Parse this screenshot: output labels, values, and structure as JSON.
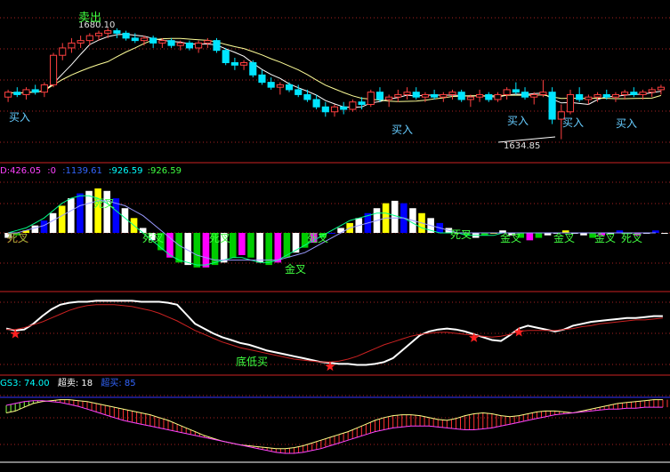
{
  "colors": {
    "background": "#000000",
    "up": "#ff4040",
    "down": "#00e5ff",
    "ma_short": "#ffffff",
    "ma_long": "#ffff99",
    "red_line": "#cc2222",
    "white_line": "#ffffff",
    "hist_blue": "#0000ff",
    "hist_yellow": "#ffff00",
    "hist_white": "#ffffff",
    "hist_green": "#00cc00",
    "hist_magenta": "#ff00ff",
    "dif": "#00ff88",
    "dea": "#9999ff",
    "dif2": "#ff40ff",
    "buy_label": "#66ccff",
    "sell_label": "#40ff40",
    "star": "#ff2020",
    "gs_green": "#88ff44",
    "gs_magenta": "#ff44ff",
    "gs_red": "#ff3333",
    "gs_yellow": "#ffff88",
    "indicator_red_text": "#ff4040",
    "indicator_blue_text": "#3366ff",
    "indicator_white_text": "#ffffff",
    "indicator_cyan_text": "#00ffff",
    "indicator_green_text": "#40ff40",
    "indicator_magenta_text": "#ff40ff"
  },
  "price_panel": {
    "high_label": "1680.10",
    "low_label": "1634.85",
    "sell_label": "卖出",
    "buy_labels": [
      "买入",
      "买入",
      "买入",
      "买入",
      "买入"
    ]
  },
  "macd_panel": {
    "header": {
      "macd": "D:426.05",
      "zero": ":0",
      "dif": ":1139.61",
      "v1": ":926.59",
      "v2": ":926.59"
    },
    "marks": {
      "die_cha": "死叉",
      "jin_cha": "金叉"
    }
  },
  "curve_panel": {
    "label": "底低买"
  },
  "gs_panel": {
    "gs3_label": "GS3:",
    "gs3_value": "74.00",
    "oversold_label": "超卖:",
    "oversold_value": "18",
    "overbought_label": "超买:",
    "overbought_value": "85"
  },
  "chart_data": [
    {
      "type": "candlestick",
      "title": "",
      "annotations": [
        "1680.10",
        "1634.85",
        "卖出",
        "买入"
      ],
      "high": 1680.1,
      "low": 1634.85,
      "ylim": [
        1630,
        1685
      ],
      "grid": true,
      "candles": [
        [
          1652,
          1655,
          1650,
          1654
        ],
        [
          1654,
          1656,
          1652,
          1653
        ],
        [
          1653,
          1656,
          1651,
          1655
        ],
        [
          1655,
          1657,
          1653,
          1654
        ],
        [
          1654,
          1658,
          1652,
          1657
        ],
        [
          1657,
          1670,
          1656,
          1669
        ],
        [
          1669,
          1674,
          1667,
          1672
        ],
        [
          1672,
          1676,
          1670,
          1674
        ],
        [
          1674,
          1677,
          1672,
          1675
        ],
        [
          1675,
          1678,
          1673,
          1677
        ],
        [
          1677,
          1679,
          1675,
          1678
        ],
        [
          1678,
          1680.1,
          1676,
          1679
        ],
        [
          1679,
          1680,
          1676,
          1678
        ],
        [
          1678,
          1679,
          1675,
          1676
        ],
        [
          1676,
          1678,
          1674,
          1675
        ],
        [
          1675,
          1677,
          1673,
          1676
        ],
        [
          1676,
          1677,
          1672,
          1674
        ],
        [
          1674,
          1676,
          1672,
          1675
        ],
        [
          1675,
          1676,
          1672,
          1673
        ],
        [
          1673,
          1675,
          1671,
          1674
        ],
        [
          1674,
          1675,
          1671,
          1672
        ],
        [
          1672,
          1675,
          1670,
          1674
        ],
        [
          1674,
          1676,
          1672,
          1675
        ],
        [
          1675,
          1676,
          1670,
          1671
        ],
        [
          1671,
          1672,
          1665,
          1666
        ],
        [
          1666,
          1668,
          1663,
          1665
        ],
        [
          1665,
          1667,
          1663,
          1666
        ],
        [
          1666,
          1667,
          1660,
          1661
        ],
        [
          1661,
          1663,
          1657,
          1658
        ],
        [
          1658,
          1660,
          1655,
          1656
        ],
        [
          1656,
          1658,
          1653,
          1657
        ],
        [
          1657,
          1658,
          1654,
          1655
        ],
        [
          1655,
          1657,
          1652,
          1653
        ],
        [
          1653,
          1655,
          1650,
          1651
        ],
        [
          1651,
          1653,
          1647,
          1648
        ],
        [
          1648,
          1650,
          1644,
          1646
        ],
        [
          1646,
          1649,
          1644,
          1648
        ],
        [
          1648,
          1650,
          1645,
          1647
        ],
        [
          1647,
          1651,
          1646,
          1650
        ],
        [
          1650,
          1652,
          1647,
          1649
        ],
        [
          1649,
          1655,
          1648,
          1654
        ],
        [
          1654,
          1656,
          1650,
          1651
        ],
        [
          1651,
          1653,
          1648,
          1652
        ],
        [
          1652,
          1655,
          1650,
          1653
        ],
        [
          1653,
          1656,
          1651,
          1654
        ],
        [
          1654,
          1656,
          1651,
          1652
        ],
        [
          1652,
          1654,
          1650,
          1653
        ],
        [
          1653,
          1655,
          1651,
          1652
        ],
        [
          1652,
          1654,
          1650,
          1653
        ],
        [
          1653,
          1655,
          1651,
          1654
        ],
        [
          1654,
          1655,
          1650,
          1651
        ],
        [
          1651,
          1653,
          1648,
          1652
        ],
        [
          1652,
          1655,
          1650,
          1653
        ],
        [
          1653,
          1654,
          1650,
          1651
        ],
        [
          1651,
          1654,
          1650,
          1653
        ],
        [
          1653,
          1656,
          1651,
          1655
        ],
        [
          1655,
          1658,
          1653,
          1654
        ],
        [
          1654,
          1656,
          1651,
          1652
        ],
        [
          1652,
          1654,
          1649,
          1653
        ],
        [
          1653,
          1659,
          1652,
          1654
        ],
        [
          1654,
          1656,
          1641,
          1643
        ],
        [
          1643,
          1649,
          1634.85,
          1646
        ],
        [
          1646,
          1655,
          1645,
          1653
        ],
        [
          1653,
          1656,
          1650,
          1651
        ],
        [
          1651,
          1653,
          1649,
          1652
        ],
        [
          1652,
          1654,
          1650,
          1653
        ],
        [
          1653,
          1655,
          1651,
          1652
        ],
        [
          1652,
          1654,
          1650,
          1653
        ],
        [
          1653,
          1655,
          1651,
          1654
        ],
        [
          1654,
          1656,
          1652,
          1653
        ],
        [
          1653,
          1655,
          1651,
          1654
        ],
        [
          1654,
          1656,
          1652,
          1655
        ],
        [
          1655,
          1657,
          1653,
          1656
        ]
      ]
    },
    {
      "type": "bar",
      "title": "",
      "header": "D:426.05 :0 :1139.61 :926.59 :926.59",
      "annotations": [
        "死叉",
        "金叉"
      ],
      "values": [
        -2,
        -1,
        1,
        3,
        5,
        8,
        11,
        14,
        16,
        17,
        18,
        17,
        14,
        10,
        6,
        2,
        -3,
        -7,
        -10,
        -12,
        -13,
        -14,
        -14,
        -13,
        -12,
        -10,
        -9,
        -10,
        -12,
        -13,
        -12,
        -10,
        -8,
        -6,
        -4,
        -2,
        0,
        2,
        4,
        6,
        8,
        10,
        12,
        13,
        12,
        10,
        8,
        6,
        4,
        2,
        0,
        -1,
        -2,
        -1,
        0,
        1,
        -1,
        -2,
        -3,
        -2,
        -1,
        0,
        1,
        0,
        -1,
        -2,
        -1,
        0,
        1,
        0,
        -1,
        0,
        1,
        0
      ],
      "lines": [
        {
          "values": [
            0,
            1,
            2,
            4,
            6,
            9,
            12,
            14,
            15,
            15,
            14,
            12,
            9,
            6,
            3,
            0,
            -3,
            -6,
            -9,
            -11,
            -12,
            -13,
            -13,
            -12,
            -11,
            -10,
            -10,
            -11,
            -12,
            -12,
            -11,
            -9,
            -7,
            -5,
            -3,
            -1,
            1,
            3,
            5,
            6,
            7,
            8,
            8,
            7,
            6,
            4,
            2,
            1,
            0,
            0,
            0,
            -1,
            -1,
            -1,
            -1,
            0,
            0,
            0,
            0,
            0,
            0,
            0,
            0,
            0,
            0,
            0,
            0,
            0,
            0,
            0,
            0,
            0,
            0
          ]
        },
        {
          "values": [
            0,
            0,
            1,
            2,
            3,
            5,
            7,
            9,
            11,
            12,
            13,
            13,
            12,
            11,
            9,
            7,
            4,
            1,
            -2,
            -5,
            -7,
            -9,
            -10,
            -11,
            -11,
            -11,
            -11,
            -11,
            -11,
            -11,
            -11,
            -10,
            -9,
            -8,
            -6,
            -4,
            -2,
            0,
            2,
            3,
            4,
            5,
            6,
            6,
            6,
            5,
            4,
            3,
            2,
            1,
            0,
            0,
            0,
            0,
            0,
            0,
            0,
            0,
            0,
            0,
            0,
            0,
            0,
            0,
            0,
            0,
            0,
            0,
            0,
            0,
            0,
            0,
            0
          ]
        }
      ]
    },
    {
      "type": "line",
      "title": "",
      "annotations": [
        "底低买"
      ],
      "series": [
        {
          "values": [
            45,
            43,
            44,
            50,
            58,
            65,
            70,
            72,
            73,
            73,
            74,
            74,
            74,
            74,
            74,
            73,
            73,
            73,
            72,
            70,
            60,
            50,
            45,
            40,
            36,
            33,
            30,
            28,
            25,
            22,
            20,
            18,
            16,
            14,
            12,
            10,
            9,
            8,
            8,
            7,
            7,
            8,
            10,
            14,
            22,
            30,
            38,
            42,
            44,
            45,
            44,
            42,
            39,
            36,
            33,
            32,
            38,
            45,
            48,
            46,
            44,
            42,
            44,
            48,
            50,
            52,
            53,
            54,
            55,
            56,
            56,
            57,
            58,
            58
          ]
        },
        {
          "values": [
            44,
            44,
            46,
            49,
            52,
            56,
            60,
            64,
            67,
            69,
            70,
            70,
            70,
            69,
            68,
            66,
            64,
            61,
            57,
            53,
            48,
            43,
            39,
            35,
            31,
            28,
            25,
            23,
            21,
            19,
            17,
            15,
            13,
            12,
            11,
            10,
            10,
            11,
            13,
            16,
            20,
            24,
            28,
            31,
            34,
            37,
            39,
            40,
            41,
            41,
            40,
            39,
            38,
            37,
            36,
            37,
            39,
            42,
            43,
            43,
            43,
            43,
            44,
            45,
            47,
            48,
            50,
            51,
            52,
            53,
            54,
            54,
            55,
            56
          ]
        }
      ],
      "markers": [
        1,
        36,
        52,
        57
      ]
    },
    {
      "type": "area",
      "title": "",
      "annotations": [
        "GS3:74.00",
        "超卖:18",
        "超买:85"
      ],
      "series": [
        {
          "values": [
            60,
            62,
            66,
            70,
            72,
            73,
            74,
            74,
            73,
            72,
            70,
            68,
            66,
            64,
            62,
            60,
            58,
            55,
            52,
            48,
            44,
            40,
            36,
            33,
            30,
            28,
            26,
            25,
            24,
            23,
            22,
            22,
            23,
            25,
            28,
            31,
            34,
            37,
            40,
            44,
            48,
            52,
            55,
            57,
            58,
            58,
            57,
            55,
            53,
            52,
            54,
            57,
            59,
            60,
            59,
            57,
            56,
            57,
            59,
            61,
            62,
            62,
            61,
            60,
            62,
            64,
            66,
            68,
            70,
            71,
            72,
            73,
            74,
            74
          ]
        },
        {
          "values": [
            68,
            70,
            72,
            73,
            73,
            72,
            71,
            69,
            67,
            64,
            61,
            58,
            55,
            52,
            50,
            48,
            46,
            44,
            42,
            40,
            38,
            36,
            34,
            32,
            30,
            28,
            26,
            24,
            22,
            20,
            18,
            17,
            17,
            18,
            20,
            22,
            25,
            28,
            31,
            34,
            37,
            40,
            42,
            44,
            45,
            46,
            46,
            46,
            45,
            44,
            43,
            42,
            42,
            43,
            44,
            46,
            48,
            50,
            52,
            54,
            56,
            58,
            59,
            60,
            61,
            62,
            63,
            64,
            64,
            65,
            65,
            66,
            66,
            66
          ]
        }
      ]
    }
  ]
}
